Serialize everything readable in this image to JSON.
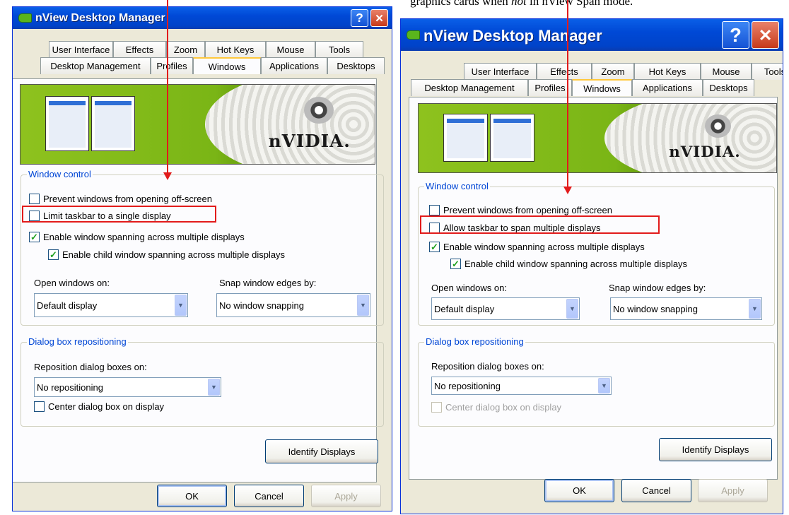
{
  "caption": {
    "pre": "graphics cards when ",
    "em": "not",
    "post": " in nView Span mode."
  },
  "left": {
    "title": "nView Desktop Manager",
    "help_label": "?",
    "close_label": "✕",
    "tabs_row1": [
      "User Interface",
      "Effects",
      "Zoom",
      "Hot Keys",
      "Mouse",
      "Tools"
    ],
    "tabs_row2": [
      "Desktop Management",
      "Profiles",
      "Windows",
      "Applications",
      "Desktops"
    ],
    "active_tab": "Windows",
    "banner_logo": "nVIDIA.",
    "window_control": {
      "legend": "Window control",
      "prevent_offscreen": {
        "label": "Prevent windows from opening off-screen",
        "checked": false
      },
      "taskbar": {
        "label": "Limit taskbar to a single display",
        "checked": false
      },
      "spanning": {
        "label": "Enable window spanning across multiple displays",
        "checked": true
      },
      "child_spanning": {
        "label": "Enable child window spanning across multiple displays",
        "checked": true
      },
      "open_on_label": "Open windows on:",
      "open_on_value": "Default display",
      "snap_label": "Snap window edges by:",
      "snap_value": "No window snapping"
    },
    "dialog_repositioning": {
      "legend": "Dialog box repositioning",
      "reposition_label": "Reposition dialog boxes on:",
      "reposition_value": "No repositioning",
      "center": {
        "label": "Center dialog box on display",
        "checked": false,
        "disabled": false
      }
    },
    "identify_label": "Identify Displays",
    "ok_label": "OK",
    "cancel_label": "Cancel",
    "apply_label": "Apply"
  },
  "right": {
    "title": "nView Desktop Manager",
    "help_label": "?",
    "close_label": "✕",
    "tabs_row1": [
      "User Interface",
      "Effects",
      "Zoom",
      "Hot Keys",
      "Mouse",
      "Tools"
    ],
    "tabs_row2": [
      "Desktop Management",
      "Profiles",
      "Windows",
      "Applications",
      "Desktops"
    ],
    "active_tab": "Windows",
    "banner_logo": "nVIDIA.",
    "window_control": {
      "legend": "Window control",
      "prevent_offscreen": {
        "label": "Prevent windows from opening off-screen",
        "checked": false
      },
      "taskbar": {
        "label": "Allow taskbar to span multiple displays",
        "checked": false
      },
      "spanning": {
        "label": "Enable window spanning across multiple displays",
        "checked": true
      },
      "child_spanning": {
        "label": "Enable child window spanning across multiple displays",
        "checked": true
      },
      "open_on_label": "Open windows on:",
      "open_on_value": "Default display",
      "snap_label": "Snap window edges by:",
      "snap_value": "No window snapping"
    },
    "dialog_repositioning": {
      "legend": "Dialog box repositioning",
      "reposition_label": "Reposition dialog boxes on:",
      "reposition_value": "No repositioning",
      "center": {
        "label": "Center dialog box on display",
        "checked": false,
        "disabled": true
      }
    },
    "identify_label": "Identify Displays",
    "ok_label": "OK",
    "cancel_label": "Cancel",
    "apply_label": "Apply"
  },
  "colors": {
    "highlight": "#E21B1B",
    "title_bar": "#0049D6",
    "dialog_bg": "#ECE9D8",
    "group_legend": "#0046D5"
  }
}
